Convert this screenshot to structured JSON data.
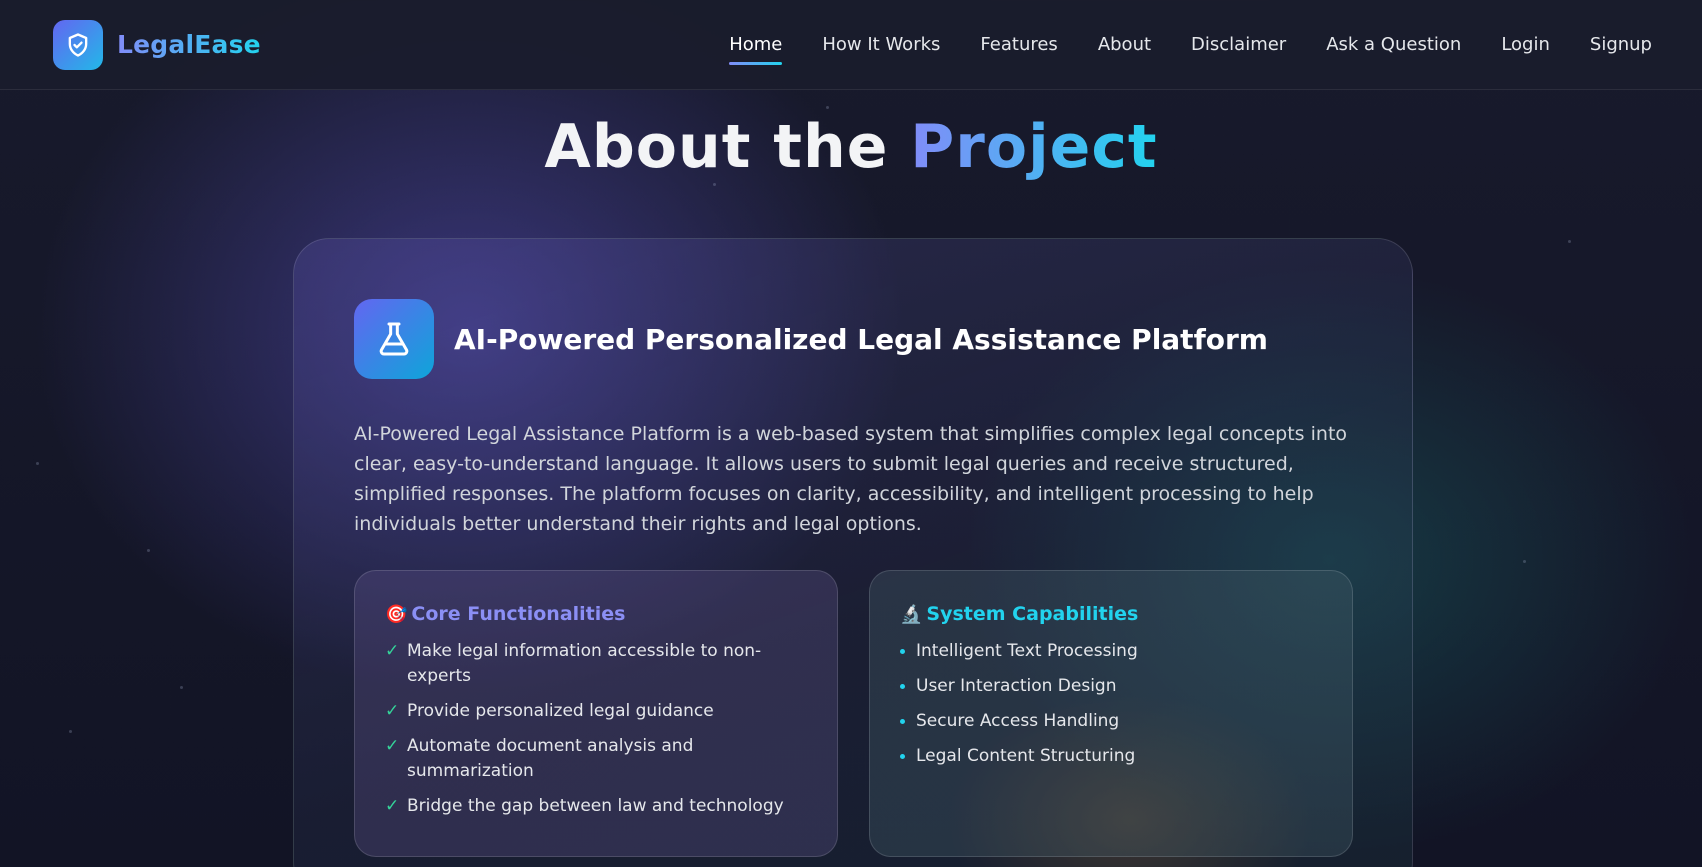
{
  "navbar": {
    "brand": "LegalEase",
    "links": [
      {
        "label": "Home",
        "active": true
      },
      {
        "label": "How It Works",
        "active": false
      },
      {
        "label": "Features",
        "active": false
      },
      {
        "label": "About",
        "active": false
      },
      {
        "label": "Disclaimer",
        "active": false
      },
      {
        "label": "Ask a Question",
        "active": false
      },
      {
        "label": "Login",
        "active": false
      },
      {
        "label": "Signup",
        "active": false
      }
    ]
  },
  "hero": {
    "title_prefix": "About the ",
    "title_accent": "Project"
  },
  "card": {
    "icon": "flask-icon",
    "title": "AI-Powered Personalized Legal Assistance Platform",
    "description": "AI-Powered Legal Assistance Platform is a web-based system that simplifies complex legal concepts into clear, easy-to-understand language. It allows users to submit legal queries and receive structured, simplified responses. The platform focuses on clarity, accessibility, and intelligent processing to help individuals better understand their rights and legal options.",
    "core": {
      "emoji": "🎯",
      "title": "Core Functionalities",
      "items": [
        "Make legal information accessible to non-experts",
        "Provide personalized legal guidance",
        "Automate document analysis and summarization",
        "Bridge the gap between law and technology"
      ]
    },
    "capabilities": {
      "emoji": "🔬",
      "title": "System Capabilities",
      "items": [
        "Intelligent Text Processing",
        "User Interaction Design",
        "Secure Access Handling",
        "Legal Content Structuring"
      ]
    }
  },
  "colors": {
    "accent_indigo": "#818cf8",
    "accent_cyan": "#22d3ee",
    "check_green": "#34d399"
  }
}
